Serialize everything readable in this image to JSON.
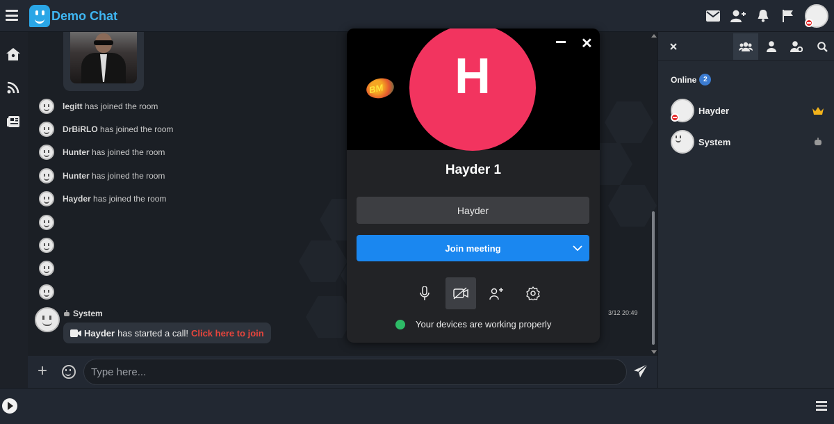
{
  "header": {
    "brand": "Demo Chat",
    "icons": [
      "menu-icon",
      "mail-icon",
      "add-friend-icon",
      "bell-icon",
      "flag-icon"
    ]
  },
  "nav": {
    "icons": [
      "home-icon",
      "rss-icon",
      "news-icon"
    ]
  },
  "chat": {
    "join_suffix": "has joined the room",
    "events": [
      {
        "user": "legitt"
      },
      {
        "user": "DrBiRLO"
      },
      {
        "user": "Hunter"
      },
      {
        "user": "Hunter"
      },
      {
        "user": "Hayder"
      }
    ],
    "system_name": "System",
    "system_time": "3/12 20:49",
    "call_user": "Hayder",
    "call_text": "has started a call!",
    "call_link": "Click here to join"
  },
  "input": {
    "placeholder": "Type here..."
  },
  "meeting": {
    "avatar_letter": "H",
    "room_name": "Hayder 1",
    "display_name": "Hayder",
    "join_label": "Join meeting",
    "device_status": "Your devices are working properly",
    "logo_text": "BM"
  },
  "sidebar": {
    "online_label": "Online",
    "online_count": "2",
    "users": [
      {
        "name": "Hayder",
        "rank_icon": "crown-icon"
      },
      {
        "name": "System",
        "rank_icon": "bot-icon"
      }
    ]
  },
  "colors": {
    "accent": "#1a87f0",
    "avatar_bg": "#f2345f",
    "link": "#e8453c",
    "status_ok": "#2dbb66",
    "online_badge": "#3b7bd0",
    "brand": "#3fb6f2"
  }
}
